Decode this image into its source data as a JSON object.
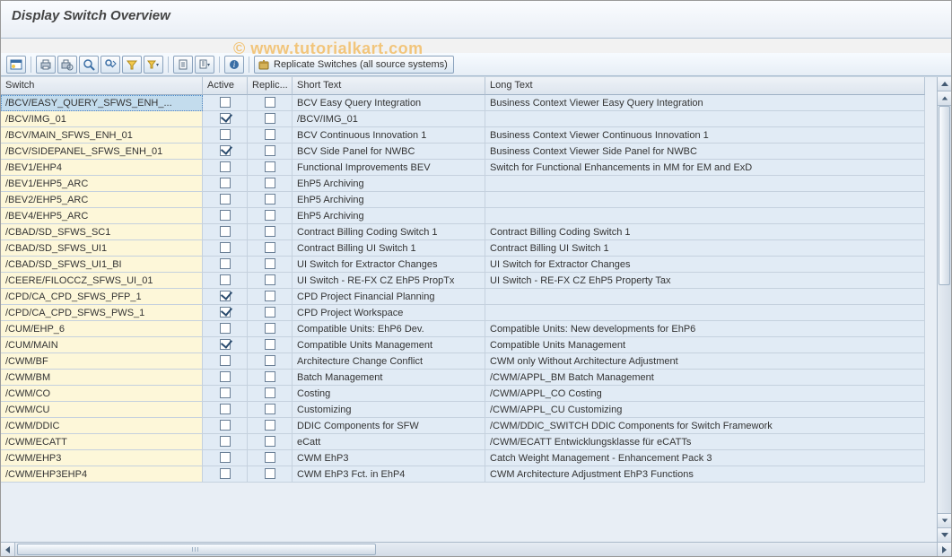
{
  "title": "Display Switch Overview",
  "watermark": "© www.tutorialkart.com",
  "toolbar": {
    "replicate_label": "Replicate Switches (all source systems)"
  },
  "columns": {
    "switch": "Switch",
    "active": "Active",
    "replic": "Replic...",
    "short_text": "Short Text",
    "long_text": "Long Text"
  },
  "rows": [
    {
      "switch": "/BCV/EASY_QUERY_SFWS_ENH_...",
      "active": false,
      "replic": false,
      "short": "BCV Easy Query Integration",
      "long": "Business Context Viewer Easy Query Integration",
      "selected": true
    },
    {
      "switch": "/BCV/IMG_01",
      "active": true,
      "replic": false,
      "short": "/BCV/IMG_01",
      "long": ""
    },
    {
      "switch": "/BCV/MAIN_SFWS_ENH_01",
      "active": false,
      "replic": false,
      "short": "BCV Continuous Innovation 1",
      "long": "Business Context Viewer Continuous Innovation 1"
    },
    {
      "switch": "/BCV/SIDEPANEL_SFWS_ENH_01",
      "active": true,
      "replic": false,
      "short": "BCV Side Panel for NWBC",
      "long": "Business Context Viewer Side Panel for NWBC"
    },
    {
      "switch": "/BEV1/EHP4",
      "active": false,
      "replic": false,
      "short": "Functional Improvements BEV",
      "long": "Switch for Functional Enhancements in MM for EM and ExD"
    },
    {
      "switch": "/BEV1/EHP5_ARC",
      "active": false,
      "replic": false,
      "short": "EhP5 Archiving",
      "long": ""
    },
    {
      "switch": "/BEV2/EHP5_ARC",
      "active": false,
      "replic": false,
      "short": "EhP5 Archiving",
      "long": ""
    },
    {
      "switch": "/BEV4/EHP5_ARC",
      "active": false,
      "replic": false,
      "short": "EhP5 Archiving",
      "long": ""
    },
    {
      "switch": "/CBAD/SD_SFWS_SC1",
      "active": false,
      "replic": false,
      "short": "Contract Billing Coding Switch 1",
      "long": "Contract Billing Coding Switch 1"
    },
    {
      "switch": "/CBAD/SD_SFWS_UI1",
      "active": false,
      "replic": false,
      "short": "Contract Billing UI Switch 1",
      "long": "Contract Billing UI Switch 1"
    },
    {
      "switch": "/CBAD/SD_SFWS_UI1_BI",
      "active": false,
      "replic": false,
      "short": "UI Switch for Extractor Changes",
      "long": "UI Switch for Extractor Changes"
    },
    {
      "switch": "/CEERE/FILOCCZ_SFWS_UI_01",
      "active": false,
      "replic": false,
      "short": "UI Switch - RE-FX CZ EhP5 PropTx",
      "long": "UI Switch - RE-FX CZ EhP5 Property Tax"
    },
    {
      "switch": "/CPD/CA_CPD_SFWS_PFP_1",
      "active": true,
      "replic": false,
      "short": "CPD Project Financial Planning",
      "long": ""
    },
    {
      "switch": "/CPD/CA_CPD_SFWS_PWS_1",
      "active": true,
      "replic": false,
      "short": "CPD Project Workspace",
      "long": ""
    },
    {
      "switch": "/CUM/EHP_6",
      "active": false,
      "replic": false,
      "short": "Compatible Units: EhP6 Dev.",
      "long": "Compatible Units: New developments for EhP6"
    },
    {
      "switch": "/CUM/MAIN",
      "active": true,
      "replic": false,
      "short": "Compatible Units Management",
      "long": "Compatible Units Management"
    },
    {
      "switch": "/CWM/BF",
      "active": false,
      "replic": false,
      "short": "Architecture Change Conflict",
      "long": "CWM only Without Architecture Adjustment"
    },
    {
      "switch": "/CWM/BM",
      "active": false,
      "replic": false,
      "short": "Batch Management",
      "long": "/CWM/APPL_BM Batch Management"
    },
    {
      "switch": "/CWM/CO",
      "active": false,
      "replic": false,
      "short": "Costing",
      "long": "/CWM/APPL_CO Costing"
    },
    {
      "switch": "/CWM/CU",
      "active": false,
      "replic": false,
      "short": "Customizing",
      "long": "/CWM/APPL_CU Customizing"
    },
    {
      "switch": "/CWM/DDIC",
      "active": false,
      "replic": false,
      "short": "DDIC Components for SFW",
      "long": "/CWM/DDIC_SWITCH DDIC Components for Switch Framework"
    },
    {
      "switch": "/CWM/ECATT",
      "active": false,
      "replic": false,
      "short": "eCatt",
      "long": "/CWM/ECATT Entwicklungsklasse für eCATTs"
    },
    {
      "switch": "/CWM/EHP3",
      "active": false,
      "replic": false,
      "short": "CWM EhP3",
      "long": "Catch Weight Management - Enhancement Pack 3"
    },
    {
      "switch": "/CWM/EHP3EHP4",
      "active": false,
      "replic": false,
      "short": "CWM EhP3 Fct. in EhP4",
      "long": "CWM Architecture Adjustment EhP3 Functions"
    }
  ]
}
